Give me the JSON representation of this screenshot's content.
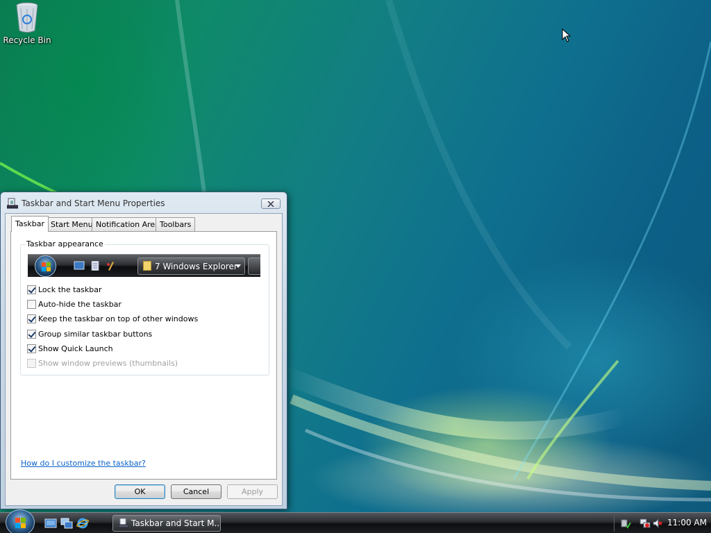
{
  "desktop": {
    "icons": [
      {
        "label": "Recycle Bin",
        "icon": "recycle-bin-icon"
      }
    ]
  },
  "dialog": {
    "title": "Taskbar and Start Menu Properties",
    "tabs": [
      {
        "label": "Taskbar",
        "active": true
      },
      {
        "label": "Start Menu",
        "active": false
      },
      {
        "label": "Notification Area",
        "active": false
      },
      {
        "label": "Toolbars",
        "active": false
      }
    ],
    "group_title": "Taskbar appearance",
    "preview": {
      "task_label": "7 Windows Explorer"
    },
    "options": [
      {
        "label": "Lock the taskbar",
        "checked": true,
        "enabled": true
      },
      {
        "label": "Auto-hide the taskbar",
        "checked": false,
        "enabled": true
      },
      {
        "label": "Keep the taskbar on top of other windows",
        "checked": true,
        "enabled": true
      },
      {
        "label": "Group similar taskbar buttons",
        "checked": true,
        "enabled": true
      },
      {
        "label": "Show Quick Launch",
        "checked": true,
        "enabled": true
      },
      {
        "label": "Show window previews (thumbnails)",
        "checked": false,
        "enabled": false
      }
    ],
    "help_link": "How do I customize the taskbar?",
    "buttons": {
      "ok": "OK",
      "cancel": "Cancel",
      "apply": "Apply"
    }
  },
  "taskbar": {
    "quick_launch": [
      "show-desktop-icon",
      "switch-windows-icon",
      "internet-explorer-icon"
    ],
    "task_button": "Taskbar and Start M...",
    "tray_icons": [
      "safely-remove-icon",
      "network-icon",
      "volume-muted-icon"
    ],
    "clock": "11:00 AM"
  },
  "colors": {
    "link": "#0b62c9",
    "taskbar": "#1c1e21",
    "dialog_frame": "#c9d8e6"
  }
}
